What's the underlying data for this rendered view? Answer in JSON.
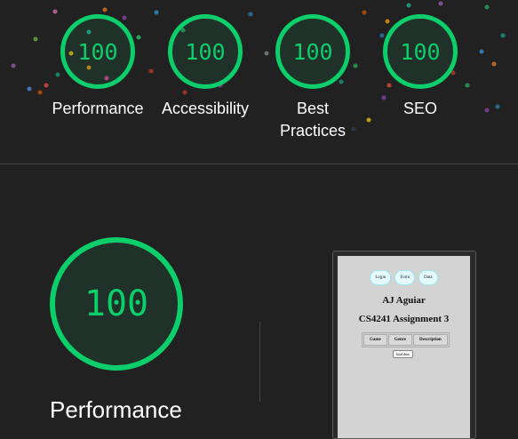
{
  "summary": {
    "gauges": [
      {
        "score": "100",
        "label": "Performance"
      },
      {
        "score": "100",
        "label": "Accessibility"
      },
      {
        "score": "100",
        "label": "Best Practices"
      },
      {
        "score": "100",
        "label": "SEO"
      }
    ]
  },
  "detail": {
    "score": "100",
    "label": "Performance"
  },
  "screenshot": {
    "nav": [
      "Login",
      "Form",
      "Data"
    ],
    "name": "AJ Aguiar",
    "course": "CS4241 Assignment 3",
    "table_headers": [
      "Game",
      "Genre",
      "Description"
    ],
    "load_button": "load data"
  },
  "colors": {
    "pass": "#0cce6b",
    "background": "#212121"
  }
}
